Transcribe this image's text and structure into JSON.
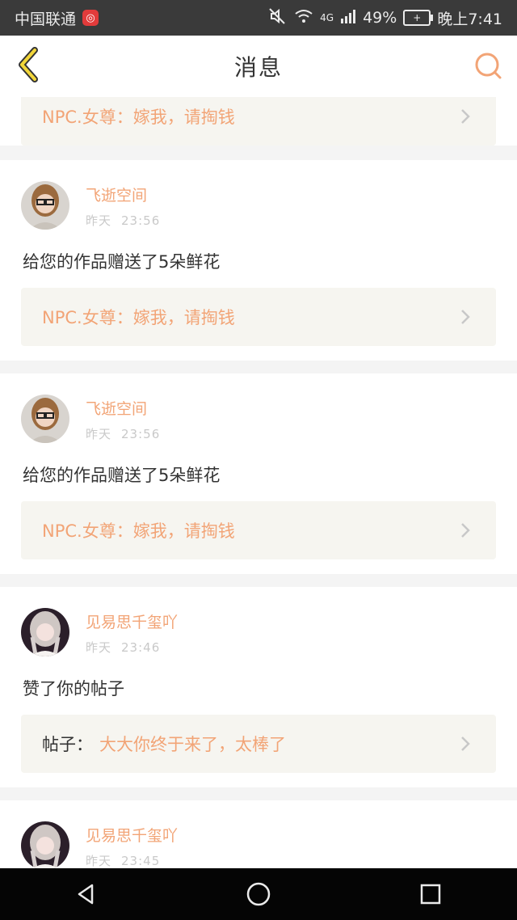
{
  "status_bar": {
    "carrier": "中国联通",
    "network_type": "4G",
    "battery_percent": "49%",
    "time": "晚上7:41"
  },
  "header": {
    "title": "消息",
    "back_icon": "chevron-left-icon",
    "search_icon": "search-icon",
    "accent_color": "#f2a476"
  },
  "top_partial": {
    "quote_text": "NPC.女尊：嫁我，请掏钱"
  },
  "messages": [
    {
      "username": "飞逝空间",
      "date": "昨天",
      "time": "23:56",
      "action": "给您的作品赠送了5朵鲜花",
      "quote_prefix": "",
      "quote_text": "NPC.女尊：嫁我，请掏钱"
    },
    {
      "username": "飞逝空间",
      "date": "昨天",
      "time": "23:56",
      "action": "给您的作品赠送了5朵鲜花",
      "quote_prefix": "",
      "quote_text": "NPC.女尊：嫁我，请掏钱"
    },
    {
      "username": "见易思千玺吖",
      "date": "昨天",
      "time": "23:46",
      "action": "赞了你的帖子",
      "quote_prefix": "帖子：",
      "quote_text": "大大你终于来了，太棒了"
    },
    {
      "username": "见易思千玺吖",
      "date": "昨天",
      "time": "23:45",
      "action": "",
      "quote_prefix": "",
      "quote_text": ""
    }
  ],
  "system_nav": {
    "back": "back-triangle-icon",
    "home": "home-circle-icon",
    "recent": "recent-square-icon"
  }
}
